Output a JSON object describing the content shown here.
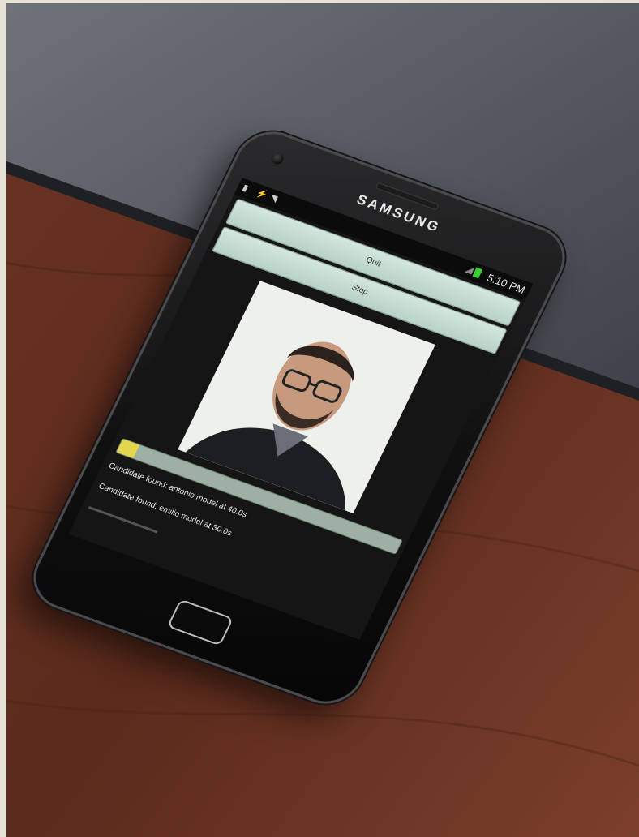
{
  "phone": {
    "brand": "SAMSUNG",
    "status_bar": {
      "time": "5:10 PM",
      "icons": [
        "sd-card-icon",
        "usb-icon",
        "wifi-icon",
        "signal-icon",
        "battery-icon"
      ]
    }
  },
  "app": {
    "quit_label": "Quit",
    "stop_label": "Stop",
    "progress": 0.06,
    "log": [
      "Candidate found: antonio model at 40.0s",
      "Candidate found: emilio model at 30.0s"
    ]
  },
  "colors": {
    "button_fill": "#c6ddd2",
    "progress_fill": "#e3d64c",
    "progress_track": "#9db0a3",
    "battery": "#35d135"
  }
}
